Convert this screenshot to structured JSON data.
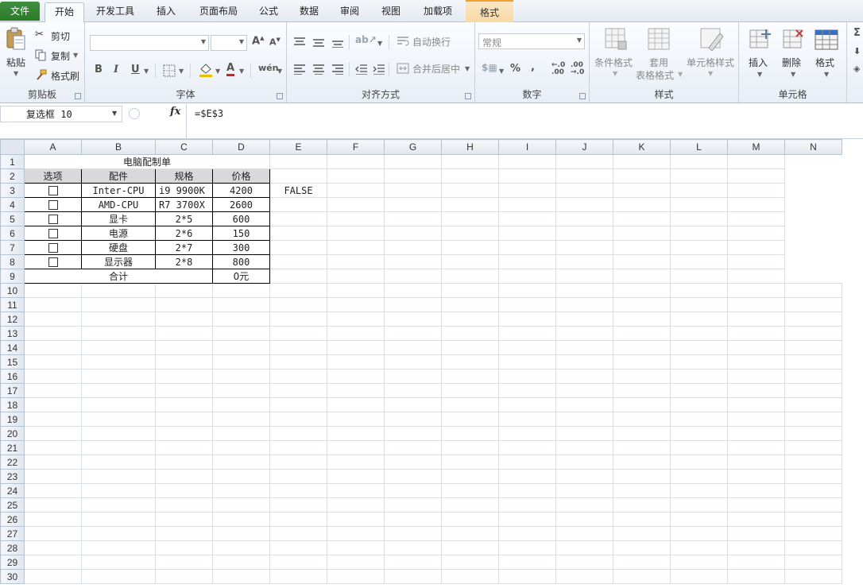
{
  "tabs": [
    "文件",
    "开始",
    "开发工具",
    "插入",
    "页面布局",
    "公式",
    "数据",
    "审阅",
    "视图",
    "加载项",
    "格式"
  ],
  "ribbon": {
    "clipboard": {
      "label": "剪贴板",
      "paste": "粘贴",
      "cut": "剪切",
      "copy": "复制",
      "format_painter": "格式刷"
    },
    "font": {
      "label": "字体"
    },
    "alignment": {
      "label": "对齐方式",
      "wrap_text": "自动换行",
      "merge_center": "合并后居中"
    },
    "number": {
      "label": "数字",
      "format_value": "常规"
    },
    "styles": {
      "label": "样式",
      "conditional_formatting": "条件格式",
      "table_format_1": "套用",
      "table_format_2": "表格格式",
      "cell_styles": "单元格样式"
    },
    "cells": {
      "label": "单元格",
      "insert": "插入",
      "delete": "删除",
      "format": "格式"
    }
  },
  "formula_bar": {
    "name_box": "复选框 10",
    "fx": "fx",
    "formula": "=$E$3"
  },
  "columns": [
    "A",
    "B",
    "C",
    "D",
    "E",
    "F",
    "G",
    "H",
    "I",
    "J",
    "K",
    "L",
    "M",
    "N"
  ],
  "sheet": {
    "title": "电脑配制单",
    "headers": [
      "选项",
      "配件",
      "规格",
      "价格"
    ],
    "rows": [
      {
        "part": "Inter-CPU",
        "spec": "i9 9900K",
        "price": "4200"
      },
      {
        "part": "AMD-CPU",
        "spec": "R7 3700X",
        "price": "2600"
      },
      {
        "part": "显卡",
        "spec": "2*5",
        "price": "600"
      },
      {
        "part": "电源",
        "spec": "2*6",
        "price": "150"
      },
      {
        "part": "硬盘",
        "spec": "2*7",
        "price": "300"
      },
      {
        "part": "显示器",
        "spec": "2*8",
        "price": "800"
      }
    ],
    "e3": "FALSE",
    "total_label": "合计",
    "total_value": "0元"
  },
  "row_numbers": [
    "1",
    "2",
    "3",
    "4",
    "5",
    "6",
    "7",
    "8",
    "9",
    "10",
    "11",
    "12",
    "13",
    "14",
    "15",
    "16",
    "17",
    "18",
    "19",
    "20",
    "21",
    "22",
    "23",
    "24",
    "25",
    "26",
    "27",
    "28",
    "29",
    "30"
  ],
  "colors": {
    "file_tab": "#2a7a2a",
    "context_tab": "#f7d8a4",
    "header_fill": "#d9d9d9"
  }
}
